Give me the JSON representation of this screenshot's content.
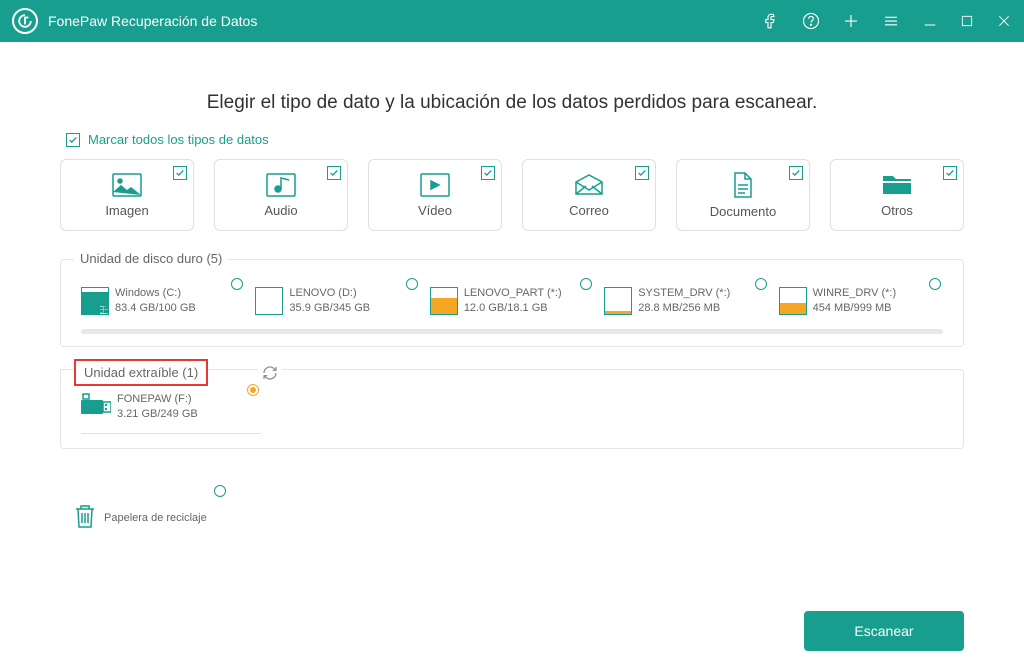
{
  "titlebar": {
    "product": "FonePaw Recuperación de Datos"
  },
  "heading": "Elegir el tipo de dato y la ubicación de los datos perdidos para escanear.",
  "select_all": "Marcar todos los tipos de datos",
  "types": {
    "image": "Imagen",
    "audio": "Audio",
    "video": "Vídeo",
    "mail": "Correo",
    "document": "Documento",
    "other": "Otros"
  },
  "hdd": {
    "label": "Unidad de disco duro (5)",
    "items": [
      {
        "name": "Windows (C:)",
        "size": "83.4 GB/100 GB",
        "fill": 85,
        "color": "teal"
      },
      {
        "name": "LENOVO (D:)",
        "size": "35.9 GB/345 GB",
        "fill": 0,
        "color": "none"
      },
      {
        "name": "LENOVO_PART (*:)",
        "size": "12.0 GB/18.1 GB",
        "fill": 65,
        "color": "orange"
      },
      {
        "name": "SYSTEM_DRV (*:)",
        "size": "28.8 MB/256 MB",
        "fill": 12,
        "color": "orange"
      },
      {
        "name": "WINRE_DRV (*:)",
        "size": "454 MB/999 MB",
        "fill": 45,
        "color": "orange"
      }
    ]
  },
  "removable": {
    "label": "Unidad extraíble (1)",
    "items": [
      {
        "name": "FONEPAW (F:)",
        "size": "3.21 GB/249 GB"
      }
    ]
  },
  "trash": {
    "label": "Papelera de reciclaje"
  },
  "scan_label": "Escanear"
}
